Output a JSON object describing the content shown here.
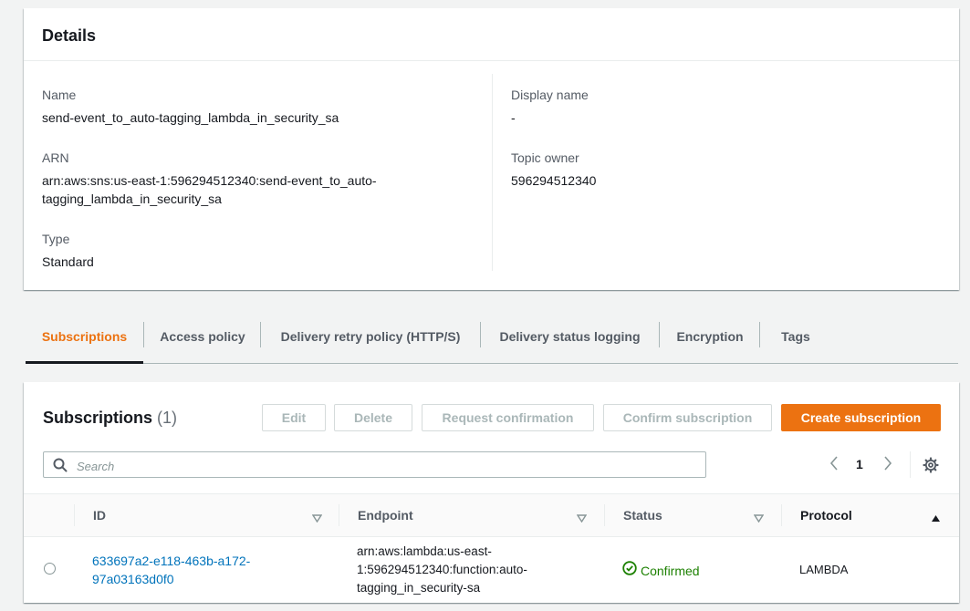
{
  "details": {
    "title": "Details",
    "name_label": "Name",
    "name_value": "send-event_to_auto-tagging_lambda_in_security_sa",
    "arn_label": "ARN",
    "arn_value_line1": "arn:aws:sns:us-east-1:596294512340:send-event_to_auto-",
    "arn_value_line2": "tagging_lambda_in_security_sa",
    "type_label": "Type",
    "type_value": "Standard",
    "display_name_label": "Display name",
    "display_name_value": "-",
    "topic_owner_label": "Topic owner",
    "topic_owner_value": "596294512340"
  },
  "tabs": [
    {
      "label": "Subscriptions",
      "active": true
    },
    {
      "label": "Access policy"
    },
    {
      "label": "Delivery retry policy (HTTP/S)"
    },
    {
      "label": "Delivery status logging"
    },
    {
      "label": "Encryption"
    },
    {
      "label": "Tags"
    }
  ],
  "subscriptions": {
    "title": "Subscriptions",
    "count": "(1)",
    "buttons": {
      "edit": "Edit",
      "delete": "Delete",
      "request_confirmation": "Request confirmation",
      "confirm_subscription": "Confirm subscription",
      "create_subscription": "Create subscription"
    },
    "search_placeholder": "Search",
    "page_number": "1",
    "columns": {
      "id": "ID",
      "endpoint": "Endpoint",
      "status": "Status",
      "protocol": "Protocol"
    },
    "rows": [
      {
        "id_line1": "633697a2-e118-463b-a172-",
        "id_line2": "97a03163d0f0",
        "endpoint_line1": "arn:aws:lambda:us-east-",
        "endpoint_line2": "1:596294512340:function:auto-",
        "endpoint_line3": "tagging_in_security-sa",
        "status": "Confirmed",
        "protocol": "LAMBDA"
      }
    ]
  },
  "colors": {
    "accent": "#ec7211",
    "link": "#0073bb",
    "success": "#1d8102"
  }
}
